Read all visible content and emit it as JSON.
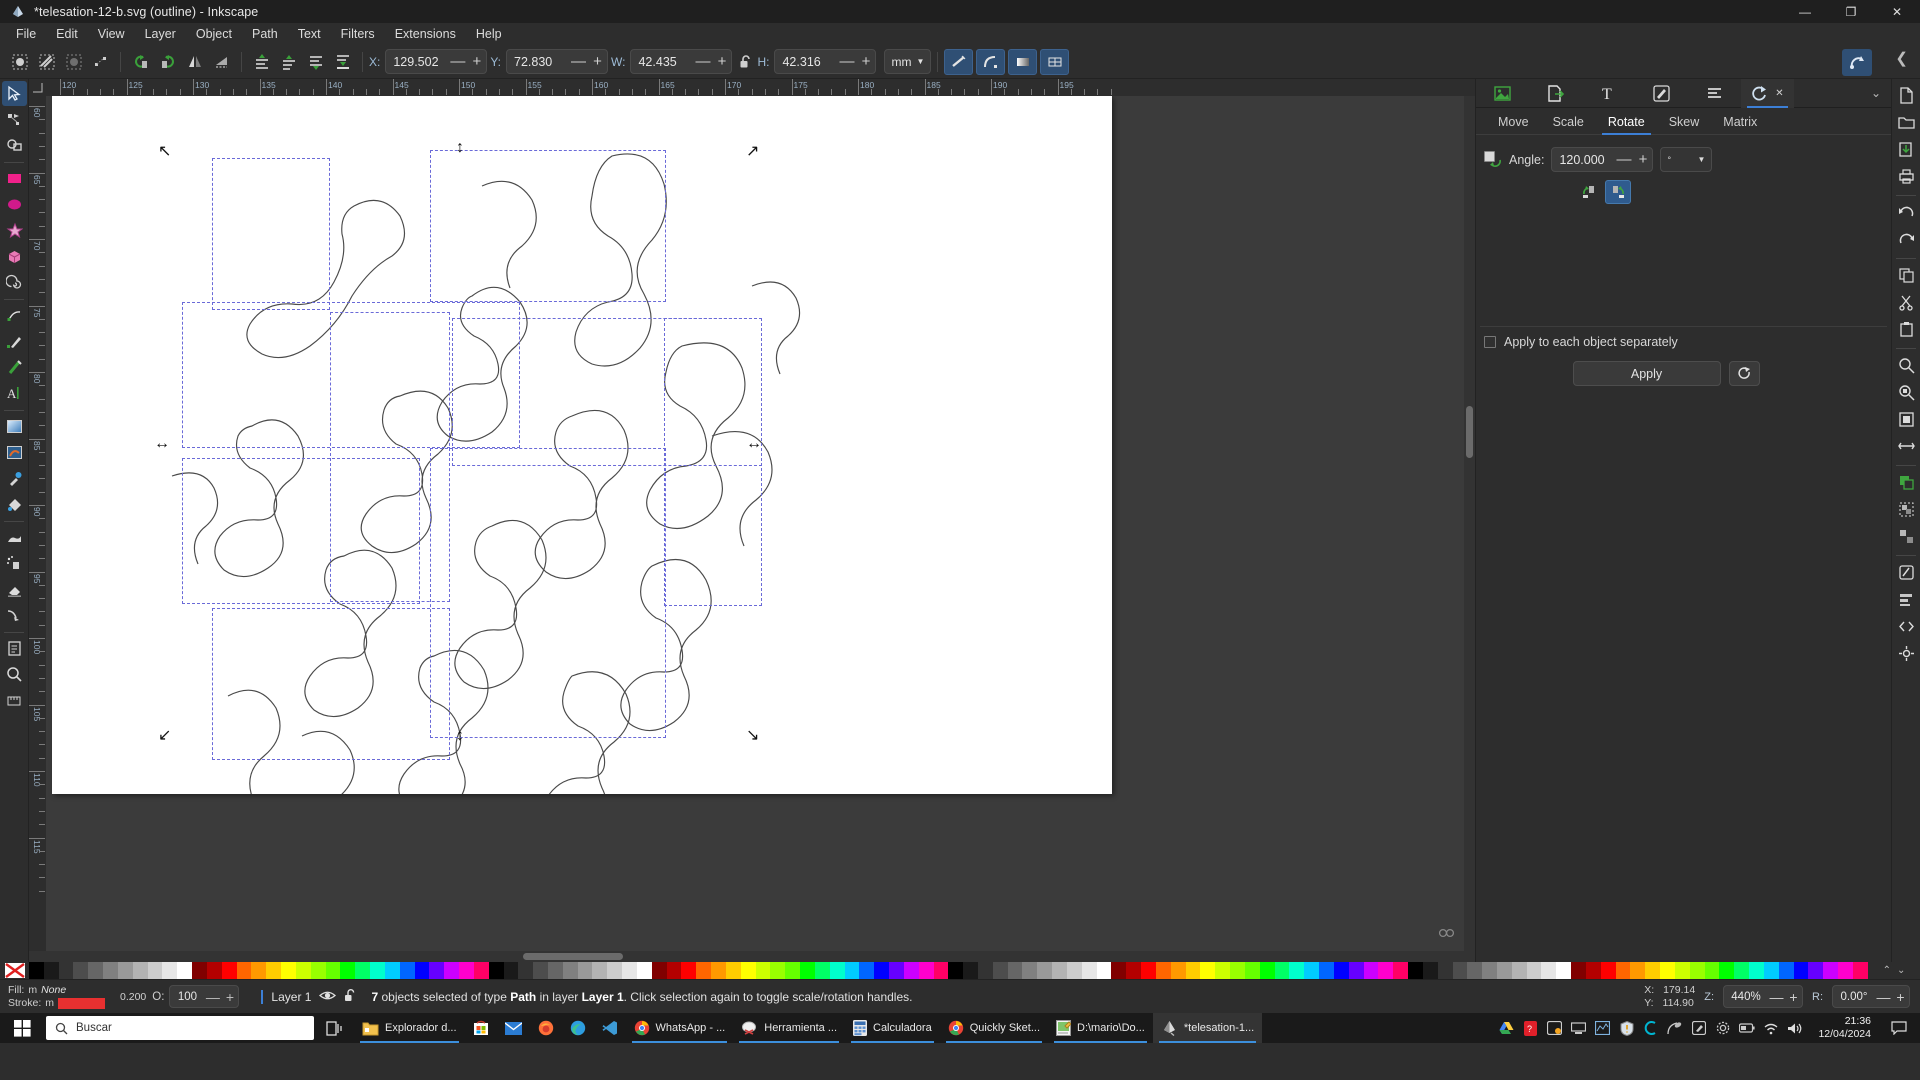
{
  "window": {
    "title": "*telesation-12-b.svg (outline) - Inkscape",
    "minimize": "—",
    "maximize": "❐",
    "close": "✕"
  },
  "menubar": {
    "items": [
      "File",
      "Edit",
      "View",
      "Layer",
      "Object",
      "Path",
      "Text",
      "Filters",
      "Extensions",
      "Help"
    ]
  },
  "toolbar": {
    "icons": [
      "select-all-icon",
      "select-all-layers-icon",
      "deselect-icon",
      "object-to-path-icon",
      "rotate-ccw-90-icon",
      "rotate-cw-90-icon",
      "flip-horizontal-icon",
      "flip-vertical-icon",
      "raise-to-top-icon",
      "raise-icon",
      "lower-icon",
      "lower-to-bottom-icon"
    ],
    "x_label": "X:",
    "x_value": "129.502",
    "y_label": "Y:",
    "y_value": "72.830",
    "w_label": "W:",
    "w_value": "42.435",
    "h_label": "H:",
    "h_value": "42.316",
    "lock_icon": "unlocked-padlock-icon",
    "unit": "mm",
    "minus": "—",
    "plus": "+",
    "affect_buttons": [
      "scale-stroke-width-icon",
      "scale-rounded-corners-icon",
      "move-gradients-icon",
      "move-patterns-icon"
    ],
    "snap_toggle": "snap-controls-icon",
    "snap_chevron": "❮"
  },
  "toolbox": {
    "tools": [
      {
        "name": "selector-tool",
        "selected": true
      },
      {
        "name": "node-editor-tool",
        "selected": false
      },
      {
        "name": "shape-builder-tool",
        "selected": false
      },
      {
        "name": "rectangle-tool",
        "selected": false
      },
      {
        "name": "ellipse-tool",
        "selected": false
      },
      {
        "name": "star-tool",
        "selected": false
      },
      {
        "name": "3dbox-tool",
        "selected": false
      },
      {
        "name": "spiral-tool",
        "selected": false
      },
      {
        "name": "pencil-tool",
        "selected": false
      },
      {
        "name": "bezier-pen-tool",
        "selected": false
      },
      {
        "name": "calligraphy-tool",
        "selected": false
      },
      {
        "name": "text-tool",
        "selected": false
      },
      {
        "name": "gradient-tool",
        "selected": false
      },
      {
        "name": "mesh-gradient-tool",
        "selected": false
      },
      {
        "name": "dropper-tool",
        "selected": false
      },
      {
        "name": "paint-bucket-tool",
        "selected": false
      },
      {
        "name": "tweak-tool",
        "selected": false
      },
      {
        "name": "spray-tool",
        "selected": false
      },
      {
        "name": "eraser-tool",
        "selected": false
      },
      {
        "name": "connector-tool",
        "selected": false
      },
      {
        "name": "page-tool",
        "selected": false
      },
      {
        "name": "zoom-tool",
        "selected": false
      },
      {
        "name": "measure-tool",
        "selected": false
      }
    ]
  },
  "rulers": {
    "unit": "mm",
    "horizontal_ticks": [
      "120",
      "125",
      "130",
      "135",
      "140",
      "145",
      "150",
      "155",
      "160",
      "165",
      "170",
      "175",
      "180",
      "185",
      "190",
      "195"
    ],
    "vertical_ticks": [
      "60",
      "65",
      "70",
      "75",
      "80",
      "85",
      "90",
      "95",
      "100",
      "105",
      "110",
      "115"
    ]
  },
  "dock": {
    "tabs": [
      {
        "name": "xml-editor-tab",
        "icon": "image-properties-icon",
        "active": false
      },
      {
        "name": "export-tab",
        "icon": "export-page-icon",
        "active": false
      },
      {
        "name": "text-properties-tab",
        "icon": "text-icon",
        "active": false
      },
      {
        "name": "fill-stroke-tab",
        "icon": "pen-edit-icon",
        "active": false
      },
      {
        "name": "layers-tab",
        "icon": "layers-icon",
        "active": false
      },
      {
        "name": "transform-tab",
        "icon": "rotate-transform-icon",
        "active": true
      }
    ],
    "close_icon": "✕",
    "chevron": "⌄"
  },
  "transform": {
    "tabs": [
      "Move",
      "Scale",
      "Rotate",
      "Skew",
      "Matrix"
    ],
    "active_tab": "Rotate",
    "angle_label": "Angle:",
    "angle_value": "120.000",
    "angle_checkbox_checked": true,
    "unit_symbol": "°",
    "dropdown_arrow": "▼",
    "direction_buttons": [
      {
        "name": "rotate-counterclockwise-button",
        "active": false
      },
      {
        "name": "rotate-clockwise-button",
        "active": true
      }
    ],
    "apply_each_label": "Apply to each object separately",
    "apply_each_checked": false,
    "apply_label": "Apply",
    "reset_icon": "reset-circular-arrow-icon",
    "minus": "—",
    "plus": "+"
  },
  "rightrail": {
    "icons": [
      "new-document-icon",
      "open-document-icon",
      "save-document-icon",
      "print-icon",
      "undo-icon",
      "redo-icon",
      "copy-icon",
      "cut-icon",
      "paste-icon",
      "zoom-drawing-icon",
      "zoom-selection-icon",
      "zoom-page-icon",
      "zoom-page-width-icon",
      "duplicate-icon",
      "group-icon",
      "ungroup-icon",
      "fill-stroke-dialog-icon",
      "align-dialog-icon",
      "xml-editor-icon",
      "preferences-icon"
    ]
  },
  "palette": {
    "none_swatch_label": "X",
    "colors": [
      "#000000",
      "#1a1a1a",
      "#333333",
      "#4d4d4d",
      "#666666",
      "#808080",
      "#999999",
      "#b3b3b3",
      "#cccccc",
      "#e6e6e6",
      "#ffffff",
      "#800000",
      "#b30000",
      "#ff0000",
      "#ff6600",
      "#ff9900",
      "#ffcc00",
      "#ffff00",
      "#ccff00",
      "#99ff00",
      "#66ff00",
      "#00ff00",
      "#00ff66",
      "#00ffcc",
      "#00ccff",
      "#0066ff",
      "#0000ff",
      "#6600ff",
      "#cc00ff",
      "#ff00cc",
      "#ff0066"
    ],
    "arrow_up": "⌃",
    "arrow_down": "⌄"
  },
  "statusbar": {
    "fill_label": "Fill:",
    "fill_marker": "m",
    "fill_value": "None",
    "stroke_label": "Stroke:",
    "stroke_marker": "m",
    "stroke_color": "#e83030",
    "stroke_width": "0.200",
    "opacity_label": "O:",
    "opacity_value": "100",
    "layer_name": "Layer 1",
    "layer_visibility_icon": "eye-open-icon",
    "layer_lock_icon": "unlocked-padlock-icon",
    "message_prefix": "7",
    "message": " objects selected of type ",
    "message_type": "Path",
    "message_mid": " in layer ",
    "message_layer": "Layer 1",
    "message_suffix": ". Click selection again to toggle scale/rotation handles.",
    "x_label": "X:",
    "x_value": "179.14",
    "y_label": "Y:",
    "y_value": "114.90",
    "zoom_label": "Z:",
    "zoom_value": "440%",
    "rotation_label": "R:",
    "rotation_value": "0.00°",
    "minus": "—",
    "plus": "+"
  },
  "taskbar": {
    "start_icon": "windows-start-icon",
    "search_placeholder": "Buscar",
    "search_icon": "search-icon",
    "taskview_icon": "task-view-icon",
    "apps": [
      {
        "label": "Explorador d...",
        "icon": "file-explorer-icon",
        "running": true,
        "active": false
      },
      {
        "label": "",
        "icon": "microsoft-store-icon",
        "running": false,
        "active": false
      },
      {
        "label": "",
        "icon": "mail-icon",
        "running": false,
        "active": false
      },
      {
        "label": "",
        "icon": "firefox-icon",
        "running": false,
        "active": false
      },
      {
        "label": "",
        "icon": "edge-icon",
        "running": false,
        "active": false
      },
      {
        "label": "",
        "icon": "vscode-icon",
        "running": false,
        "active": false
      },
      {
        "label": "WhatsApp - ...",
        "icon": "chrome-icon",
        "running": true,
        "active": false
      },
      {
        "label": "Herramienta ...",
        "icon": "snipping-tool-icon",
        "running": true,
        "active": false
      },
      {
        "label": "Calculadora",
        "icon": "calculator-icon",
        "running": true,
        "active": false
      },
      {
        "label": "Quickly Sket...",
        "icon": "chrome-icon",
        "running": true,
        "active": false
      },
      {
        "label": "D:\\mario\\Do...",
        "icon": "notepad-icon",
        "running": true,
        "active": false
      },
      {
        "label": "*telesation-1...",
        "icon": "inkscape-icon",
        "running": true,
        "active": true
      }
    ],
    "tray_icons": [
      "google-drive-icon",
      "adobe-icon",
      "screenshot-icon",
      "display-icon",
      "network-monitor-icon",
      "warning-shield-icon",
      "logitech-icon",
      "satellite-icon",
      "pen-icon",
      "settings-gear-icon",
      "battery-icon",
      "wifi-icon",
      "volume-icon"
    ],
    "time": "21:36",
    "date": "12/04/2024",
    "notification_icon": "notification-bell-icon"
  },
  "canvas": {
    "selection_handles": "arrow-handles",
    "page_background": "#ffffff",
    "selection_box_color": "#6a6ad8"
  }
}
